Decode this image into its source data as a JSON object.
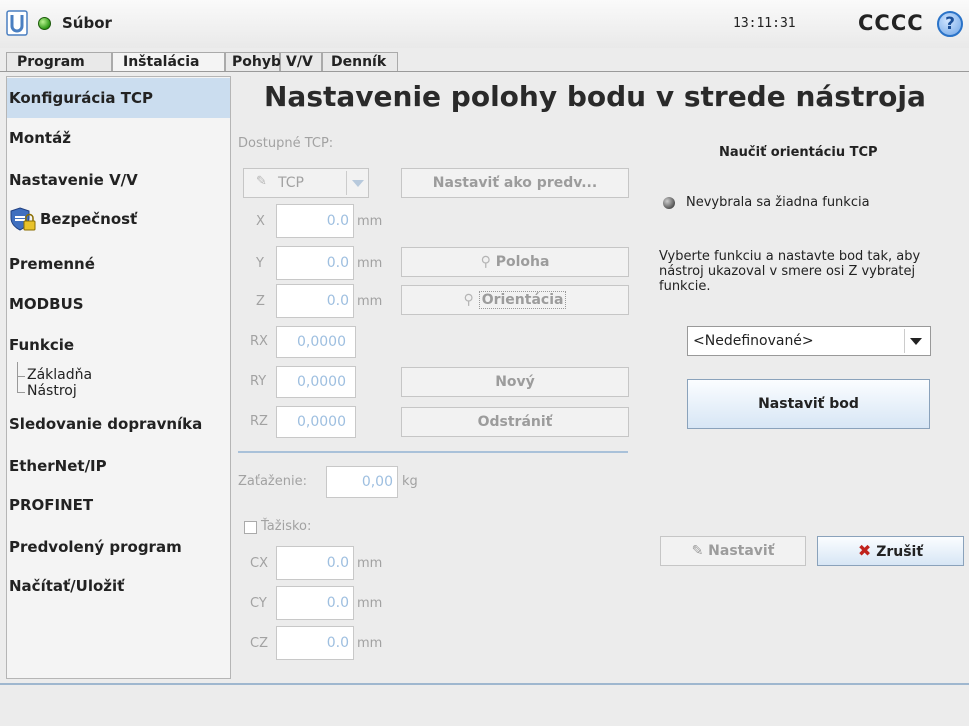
{
  "header": {
    "file_menu": "Súbor",
    "time": "13:11:31",
    "robot_name": "CCCC",
    "help": "?"
  },
  "tabs": [
    {
      "label": "Program"
    },
    {
      "label": "Inštalácia"
    },
    {
      "label": "Pohyb"
    },
    {
      "label": "V/V"
    },
    {
      "label": "Denník"
    }
  ],
  "sidebar": {
    "items": [
      {
        "label": "Konfigurácia TCP"
      },
      {
        "label": "Montáž"
      },
      {
        "label": "Nastavenie V/V"
      },
      {
        "label": "Bezpečnosť"
      },
      {
        "label": "Premenné"
      },
      {
        "label": "MODBUS"
      },
      {
        "label": "Funkcie"
      },
      {
        "label": "Sledovanie dopravníka"
      },
      {
        "label": "EtherNet/IP"
      },
      {
        "label": "PROFINET"
      },
      {
        "label": "Predvolený program"
      },
      {
        "label": "Načítať/Uložiť"
      }
    ],
    "sub_items": [
      {
        "label": "Základňa"
      },
      {
        "label": "Nástroj"
      }
    ]
  },
  "main": {
    "title": "Nastavenie polohy bodu v strede nástroja",
    "available_tcp_label": "Dostupné TCP:",
    "tcp_select": "TCP",
    "set_default_button": "Nastaviť ako predv...",
    "position_fields": [
      {
        "label": "X",
        "value": "0.0",
        "unit": "mm"
      },
      {
        "label": "Y",
        "value": "0.0",
        "unit": "mm"
      },
      {
        "label": "Z",
        "value": "0.0",
        "unit": "mm"
      }
    ],
    "rotation_fields": [
      {
        "label": "RX",
        "value": "0,0000"
      },
      {
        "label": "RY",
        "value": "0,0000"
      },
      {
        "label": "RZ",
        "value": "0,0000"
      }
    ],
    "position_button": "Poloha",
    "orientation_button": "Orientácia",
    "new_button": "Nový",
    "remove_button": "Odstrániť",
    "payload_label": "Zaťaženie:",
    "payload_value": "0,00",
    "payload_unit": "kg",
    "cog_label": "Ťažisko:",
    "cog_fields": [
      {
        "label": "CX",
        "value": "0.0",
        "unit": "mm"
      },
      {
        "label": "CY",
        "value": "0.0",
        "unit": "mm"
      },
      {
        "label": "CZ",
        "value": "0.0",
        "unit": "mm"
      }
    ]
  },
  "teach": {
    "title": "Naučiť orientáciu TCP",
    "status": "Nevybrala sa žiadna funkcia",
    "instructions": "Vyberte funkciu a nastavte bod tak, aby nástroj ukazoval v smere osi Z vybratej funkcie.",
    "feature_select": "<Nedefinované>",
    "set_point_button": "Nastaviť bod",
    "apply_button": "Nastaviť",
    "cancel_button": "Zrušiť"
  },
  "colors": {
    "accent_blue": "#cbddef",
    "status_green": "#2f9a18",
    "cancel_red": "#c0221c"
  }
}
